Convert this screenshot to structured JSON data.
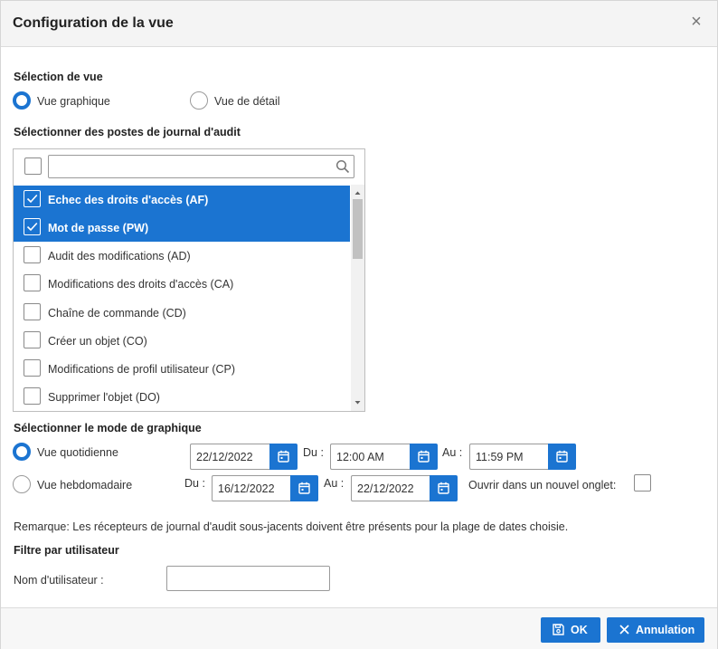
{
  "dialog": {
    "title": "Configuration de la vue",
    "close_icon": "close-icon"
  },
  "view_selection": {
    "label": "Sélection de vue",
    "options": [
      {
        "label": "Vue graphique",
        "selected": true
      },
      {
        "label": "Vue de détail",
        "selected": false
      }
    ]
  },
  "audit_entries": {
    "label": "Sélectionner des postes de journal d'audit",
    "search_value": "",
    "items": [
      {
        "label": "Echec des droits d'accès (AF)",
        "checked": true
      },
      {
        "label": "Mot de passe (PW)",
        "checked": true
      },
      {
        "label": "Audit des modifications (AD)",
        "checked": false
      },
      {
        "label": "Modifications des droits d'accès (CA)",
        "checked": false
      },
      {
        "label": "Chaîne de commande (CD)",
        "checked": false
      },
      {
        "label": "Créer un objet (CO)",
        "checked": false
      },
      {
        "label": "Modifications de profil utilisateur (CP)",
        "checked": false
      },
      {
        "label": "Supprimer l'objet (DO)",
        "checked": false
      }
    ]
  },
  "graph_mode": {
    "label": "Sélectionner le mode de graphique",
    "daily": {
      "label": "Vue quotidienne",
      "selected": true,
      "date": "22/12/2022",
      "from_label": "Du :",
      "from_time": "12:00 AM",
      "to_label": "Au :",
      "to_time": "11:59 PM"
    },
    "weekly": {
      "label": "Vue hebdomadaire",
      "selected": false,
      "from_label": "Du :",
      "from_date": "16/12/2022",
      "to_label": "Au :",
      "to_date": "22/12/2022"
    },
    "new_tab_label": "Ouvrir dans un nouvel onglet:"
  },
  "remark": "Remarque: Les récepteurs de journal d'audit sous-jacents doivent être présents pour la plage de dates choisie.",
  "user_filter": {
    "label": "Filtre par utilisateur",
    "username_label": "Nom d'utilisateur :",
    "username_value": ""
  },
  "footer": {
    "ok_label": "OK",
    "cancel_label": "Annulation"
  },
  "colors": {
    "accent": "#1b74d1",
    "header_bg": "#f4f4f4"
  }
}
